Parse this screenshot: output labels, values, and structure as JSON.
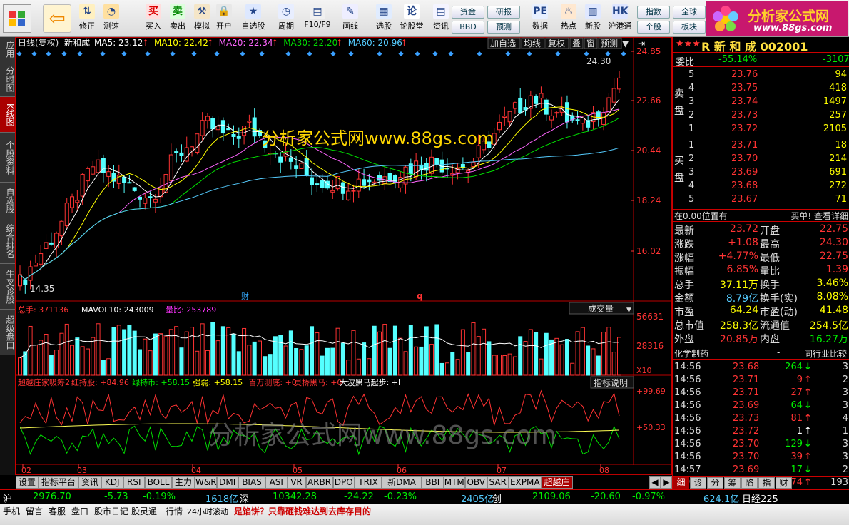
{
  "toolbar": {
    "buttons": [
      {
        "label": "修正",
        "icon": "arrow-up-down-icon"
      },
      {
        "label": "测速",
        "icon": "speedometer-icon"
      },
      {
        "label": "买入",
        "icon": "buy-icon"
      },
      {
        "label": "卖出",
        "icon": "sell-icon"
      },
      {
        "label": "模拟",
        "icon": "hammer-icon"
      },
      {
        "label": "开户",
        "icon": "lock-icon"
      },
      {
        "label": "自选股",
        "icon": "star-list-icon"
      },
      {
        "label": "周期",
        "icon": "clock-icon"
      },
      {
        "label": "F10/F9",
        "icon": "document-icon"
      },
      {
        "label": "画线",
        "icon": "pencil-icon"
      },
      {
        "label": "选股",
        "icon": "screen-icon"
      },
      {
        "label": "论股堂",
        "icon": "chat-icon"
      },
      {
        "label": "资讯",
        "icon": "news-icon"
      },
      {
        "label": "数据",
        "icon": "pe-icon"
      },
      {
        "label": "热点",
        "icon": "fire-icon"
      },
      {
        "label": "新股",
        "icon": "bars-icon"
      },
      {
        "label": "沪港通",
        "icon": "hk-icon"
      }
    ],
    "pills": [
      "资金",
      "研报",
      "BBD",
      "预测",
      "指数",
      "全球",
      "个股",
      "板块"
    ],
    "logo_text": "分析家公式网",
    "logo_url": "www.88gs.com"
  },
  "left_tabs": [
    "应用",
    "分时图",
    "K线图",
    "个股资料",
    "自选股",
    "综合排名",
    "牛叉诊股",
    "超级盘口"
  ],
  "kline": {
    "title": "日线(复权)",
    "stock": "新和成",
    "ma": [
      {
        "label": "MA5: 23.12",
        "color": "#ffffff"
      },
      {
        "label": "MA10: 22.42",
        "color": "#ffff00"
      },
      {
        "label": "MA20: 22.34",
        "color": "#ff66ff"
      },
      {
        "label": "MA30: 22.20",
        "color": "#00dd00"
      },
      {
        "label": "MA60: 20.96",
        "color": "#55ccff"
      }
    ],
    "buttons": [
      "加自选",
      "均线",
      "复权",
      "叠",
      "窗",
      "预测"
    ],
    "yticks": [
      "24.85",
      "22.66",
      "20.44",
      "18.24",
      "16.02"
    ],
    "high_label": "24.30",
    "low_label": "14.35",
    "marker_cai": "财",
    "marker_q": "q",
    "watermark": "分析家公式网www.88gs.com"
  },
  "volume": {
    "label_total": "总手: 371136",
    "label_mavol": "MAVOL10: 243009",
    "label_ratio": "量比: 253789",
    "dropdown": "成交量",
    "yticks": [
      "56631",
      "28316"
    ],
    "unit": "X10"
  },
  "indicator": {
    "name": "超越庄家吸筹2",
    "items": [
      {
        "t": "红持股: +84.96",
        "c": "#ff3333"
      },
      {
        "t": "绿持币: +58.15",
        "c": "#00ee00"
      },
      {
        "t": "强弱: +58.15",
        "c": "#ffff00"
      },
      {
        "t": "百万测底: +0",
        "c": "#ff3333"
      },
      {
        "t": "灵桥黑马: +0",
        "c": "#ff3333"
      },
      {
        "t": "大波黑马起步: +I",
        "c": "#ffffff"
      }
    ],
    "explain": "指标说明",
    "yticks": [
      "+99.69",
      "+50.33"
    ],
    "watermark": "分析家公式网www.88gs.com"
  },
  "xaxis": [
    "02",
    "03",
    "04",
    "05",
    "06",
    "07",
    "08"
  ],
  "bottom_tabs": [
    "设置",
    "指标平台",
    "资讯",
    "KDJ",
    "RSI",
    "BOLL",
    "主力",
    "W&R",
    "DMI",
    "BIAS",
    "ASI",
    "VR",
    "ARBR",
    "DPO",
    "TRIX",
    "新DMA",
    "BBI",
    "MTM",
    "OBV",
    "SAR",
    "EXPMA",
    "超越庄"
  ],
  "right_panel": {
    "stars": "★★★",
    "code_label": "R 新 和 成 002001",
    "weibi": {
      "label": "委比",
      "value": "-55.14%",
      "diff": "-3107"
    },
    "sell": [
      {
        "n": "5",
        "p": "23.76",
        "v": "94"
      },
      {
        "n": "4",
        "p": "23.75",
        "v": "418"
      },
      {
        "n": "3",
        "p": "23.74",
        "v": "1497"
      },
      {
        "n": "2",
        "p": "23.73",
        "v": "257"
      },
      {
        "n": "1",
        "p": "23.72",
        "v": "2105"
      }
    ],
    "buy": [
      {
        "n": "1",
        "p": "23.71",
        "v": "18"
      },
      {
        "n": "2",
        "p": "23.70",
        "v": "214"
      },
      {
        "n": "3",
        "p": "23.69",
        "v": "691"
      },
      {
        "n": "4",
        "p": "23.68",
        "v": "272"
      },
      {
        "n": "5",
        "p": "23.67",
        "v": "71"
      }
    ],
    "sell_side": "卖盘",
    "buy_side": "买盘",
    "pos_text": "在0.00位置有",
    "buy_link": "买单! 查看详细",
    "quote": [
      [
        "最新",
        "23.72",
        "开盘",
        "22.75"
      ],
      [
        "涨跌",
        "+1.08",
        "最高",
        "24.30"
      ],
      [
        "涨幅",
        "+4.77%",
        "最低",
        "22.75"
      ],
      [
        "振幅",
        "6.85%",
        "量比",
        "1.39"
      ],
      [
        "总手",
        "37.11万",
        "换手",
        "3.46%"
      ],
      [
        "金额",
        "8.79亿",
        "换手(实)",
        "8.08%"
      ],
      [
        "市盈",
        "64.24",
        "市盈(动)",
        "41.48"
      ],
      [
        "总市值",
        "258.3亿",
        "流通值",
        "254.5亿"
      ],
      [
        "外盘",
        "20.85万",
        "内盘",
        "16.27万"
      ]
    ],
    "industry": "化学制药",
    "compare": "同行业比较",
    "ticks": [
      {
        "t": "14:56",
        "p": "23.68",
        "v": "264",
        "d": "down",
        "x": "3"
      },
      {
        "t": "14:56",
        "p": "23.71",
        "v": "9",
        "d": "up",
        "x": "2"
      },
      {
        "t": "14:56",
        "p": "23.71",
        "v": "27",
        "d": "up",
        "x": "3"
      },
      {
        "t": "14:56",
        "p": "23.69",
        "v": "64",
        "d": "down",
        "x": "3"
      },
      {
        "t": "14:56",
        "p": "23.73",
        "v": "81",
        "d": "up",
        "x": "4"
      },
      {
        "t": "14:56",
        "p": "23.72",
        "v": "1",
        "d": "flat",
        "x": "1"
      },
      {
        "t": "14:56",
        "p": "23.70",
        "v": "129",
        "d": "down",
        "x": "3"
      },
      {
        "t": "14:56",
        "p": "23.70",
        "v": "39",
        "d": "up",
        "x": "3"
      },
      {
        "t": "14:57",
        "p": "23.69",
        "v": "17",
        "d": "down",
        "x": "2"
      },
      {
        "t": "15:00",
        "p": "23.72",
        "v": "3974",
        "d": "up",
        "x": "193"
      }
    ],
    "tabs": [
      "细",
      "诊",
      "分",
      "筹",
      "陷",
      "指",
      "财"
    ]
  },
  "index_bar": [
    {
      "t": "沪",
      "c": "#ffffff"
    },
    {
      "t": "2976.70",
      "c": "#00ee00"
    },
    {
      "t": "-5.73",
      "c": "#00ee00"
    },
    {
      "t": "-0.19%",
      "c": "#00ee00"
    },
    {
      "t": "1618亿",
      "c": "#55ccff"
    },
    {
      "t": "深",
      "c": "#ffffff"
    },
    {
      "t": "10342.28",
      "c": "#00ee00"
    },
    {
      "t": "-24.22",
      "c": "#00ee00"
    },
    {
      "t": "-0.23%",
      "c": "#00ee00"
    },
    {
      "t": "2405亿",
      "c": "#55ccff"
    },
    {
      "t": "创",
      "c": "#ffffff"
    },
    {
      "t": "2109.06",
      "c": "#00ee00"
    },
    {
      "t": "-20.60",
      "c": "#00ee00"
    },
    {
      "t": "-0.97%",
      "c": "#00ee00"
    },
    {
      "t": "624.1亿",
      "c": "#55ccff"
    },
    {
      "t": "日经225",
      "c": "#ffffff"
    }
  ],
  "status": {
    "items": [
      "手机",
      "留言",
      "客服",
      "盘口",
      "股市日记",
      "股灵通",
      "行情",
      "24小时滚动"
    ],
    "ticker": "是馅饼？只靠砸钱难达到去库存目的"
  }
}
